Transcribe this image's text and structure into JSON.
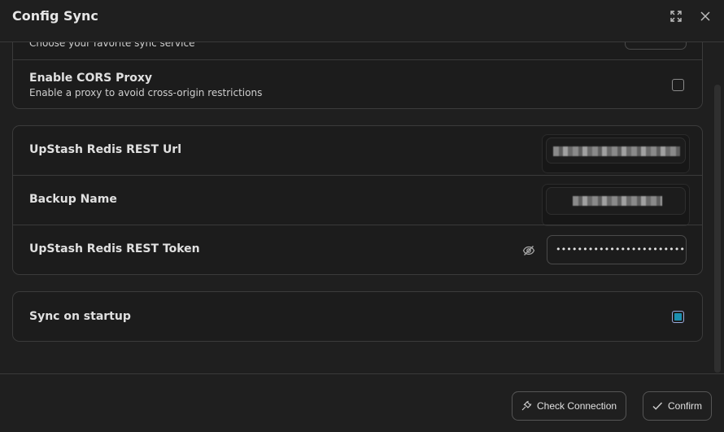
{
  "modal": {
    "title": "Config Sync",
    "icons": {
      "maximize": "maximize-icon",
      "close": "close-icon"
    }
  },
  "provider_card": {
    "service_desc": "Choose your favorite sync service",
    "cors_title": "Enable CORS Proxy",
    "cors_desc": "Enable a proxy to avoid cross-origin restrictions",
    "cors_checked": false
  },
  "upstash_card": {
    "url_label": "UpStash Redis REST Url",
    "backup_label": "Backup Name",
    "token_label": "UpStash Redis REST Token",
    "token_value": "•••••••••••••••••••••••••••••••",
    "eye_icon": "eye-off-icon"
  },
  "startup_card": {
    "label": "Sync on startup",
    "checked": true
  },
  "footer": {
    "check_connection": "Check Connection",
    "confirm": "Confirm",
    "icons": {
      "check_connection": "plug-icon",
      "confirm": "checkmark-icon"
    }
  },
  "colors": {
    "accent": "#1b8fb0",
    "border": "#3b3b3b",
    "background": "#1f1f1f"
  }
}
